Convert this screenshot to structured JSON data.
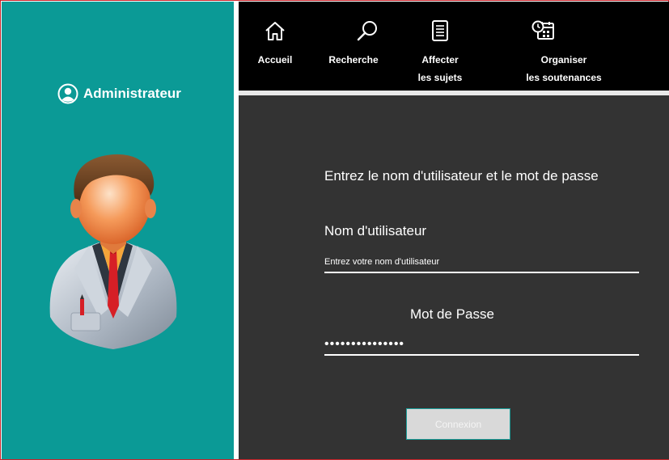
{
  "sidebar": {
    "title": "Administrateur",
    "title_icon": "user-circle-icon",
    "avatar": "businessman-avatar",
    "background": "#0b9a96"
  },
  "nav": {
    "items": [
      {
        "label_line1": "Accueil",
        "label_line2": "",
        "icon": "home-icon"
      },
      {
        "label_line1": "Recherche",
        "label_line2": "",
        "icon": "search-icon"
      },
      {
        "label_line1": "Affecter",
        "label_line2": "les sujets",
        "icon": "document-list-icon"
      },
      {
        "label_line1": "Organiser",
        "label_line2": "les soutenances",
        "icon": "calendar-clock-icon"
      }
    ],
    "background": "#000000"
  },
  "form": {
    "prompt": "Entrez le nom d'utilisateur et le mot de passe",
    "username_label": "Nom d'utilisateur",
    "username_value": "Entrez votre nom d'utilisateur",
    "password_label": "Mot de Passe",
    "password_value": "•••••••••••••••",
    "login_label": "Connexion",
    "background": "#333333"
  }
}
